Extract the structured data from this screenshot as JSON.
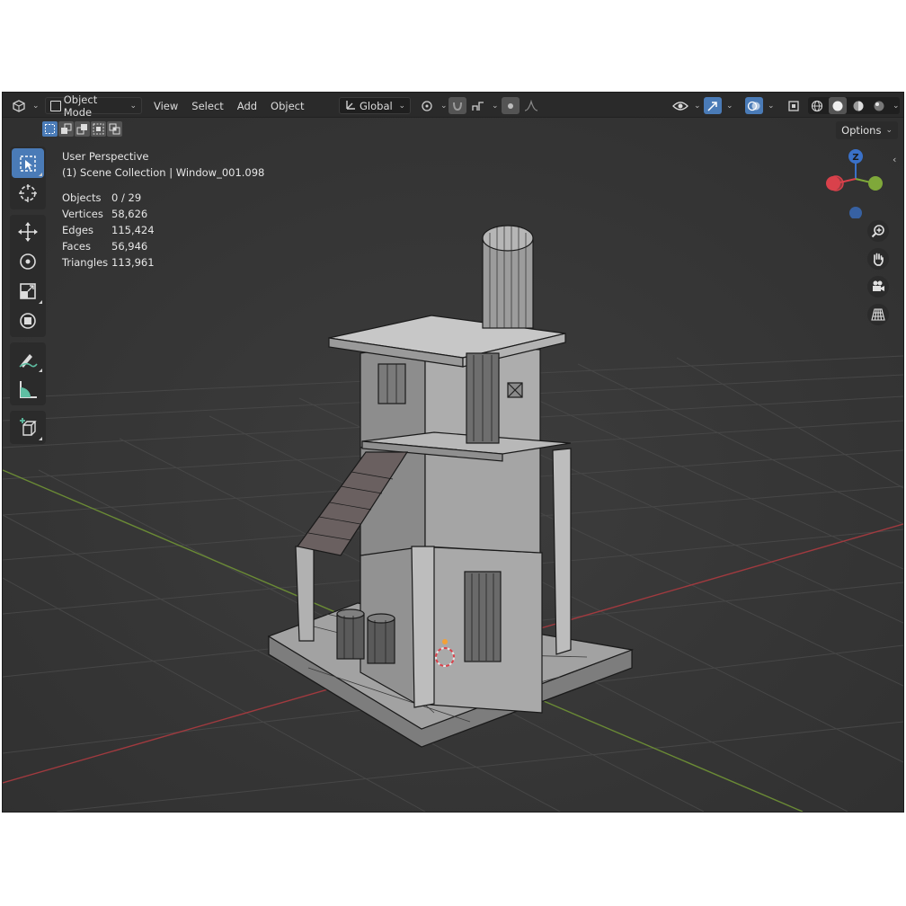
{
  "header": {
    "editor_icon": "3d-viewport-icon",
    "mode_label": "Object Mode",
    "menus": [
      "View",
      "Select",
      "Add",
      "Object"
    ],
    "orientation_label": "Global",
    "options_label": "Options"
  },
  "overlay": {
    "perspective": "User Perspective",
    "collection": "(1) Scene Collection | Window_001.098"
  },
  "stats": [
    {
      "label": "Objects",
      "value": "0 / 29"
    },
    {
      "label": "Vertices",
      "value": "58,626"
    },
    {
      "label": "Edges",
      "value": "115,424"
    },
    {
      "label": "Faces",
      "value": "56,946"
    },
    {
      "label": "Triangles",
      "value": "113,961"
    }
  ],
  "gizmo": {
    "z_label": "Z"
  },
  "tools": [
    {
      "name": "select-box-icon",
      "active": true
    },
    {
      "name": "cursor-icon",
      "active": false
    },
    {
      "name": "move-icon",
      "active": false
    },
    {
      "name": "rotate-icon",
      "active": false
    },
    {
      "name": "scale-icon",
      "active": false
    },
    {
      "name": "transform-icon",
      "active": false
    },
    {
      "name": "annotate-icon",
      "active": false
    },
    {
      "name": "measure-icon",
      "active": false
    },
    {
      "name": "add-cube-icon",
      "active": false
    }
  ],
  "colors": {
    "accent": "#4a7bb7",
    "axis_x": "#d9414b",
    "axis_y": "#7fa83a",
    "axis_z": "#3a71c8",
    "background": "#3a3a3a"
  }
}
